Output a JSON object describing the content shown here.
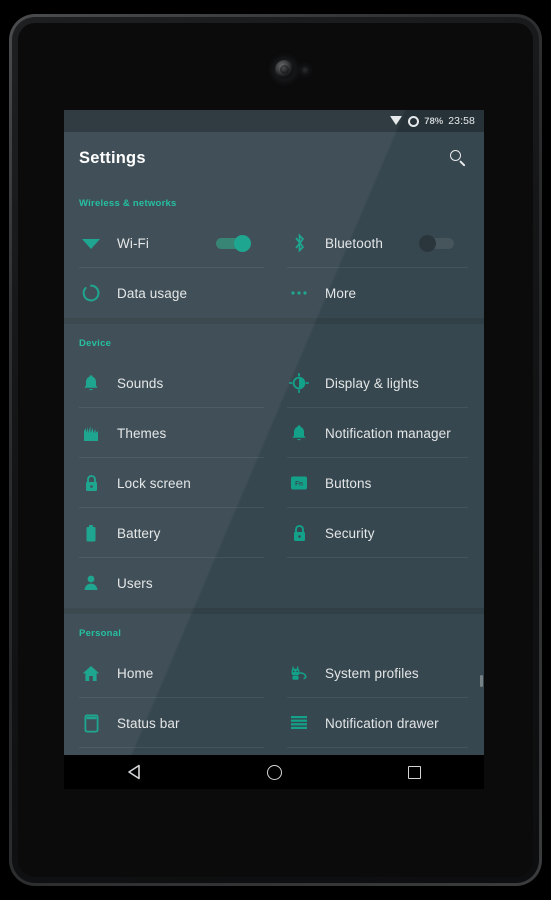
{
  "device": {
    "type": "android-tablet"
  },
  "statusbar": {
    "wifi_icon": "wifi-icon",
    "sync_icon": "ring-icon",
    "battery_percent": "78%",
    "clock": "23:58"
  },
  "appbar": {
    "title": "Settings",
    "search_icon": "search-icon"
  },
  "accent_color": "#1abc9c",
  "screen_bg": "#37474f",
  "sections": [
    {
      "header": "Wireless & networks",
      "items": [
        {
          "label": "Wi-Fi",
          "icon": "wifi-icon",
          "toggle": "on"
        },
        {
          "label": "Bluetooth",
          "icon": "bluetooth-icon",
          "toggle": "off"
        },
        {
          "label": "Data usage",
          "icon": "data-usage-icon"
        },
        {
          "label": "More",
          "icon": "more-icon"
        }
      ]
    },
    {
      "header": "Device",
      "items": [
        {
          "label": "Sounds",
          "icon": "bell-icon"
        },
        {
          "label": "Display & lights",
          "icon": "brightness-icon"
        },
        {
          "label": "Themes",
          "icon": "themes-icon"
        },
        {
          "label": "Notification manager",
          "icon": "bell-icon"
        },
        {
          "label": "Lock screen",
          "icon": "lock-icon"
        },
        {
          "label": "Buttons",
          "icon": "fn-key-icon"
        },
        {
          "label": "Battery",
          "icon": "battery-icon"
        },
        {
          "label": "Security",
          "icon": "lock-icon"
        },
        {
          "label": "Users",
          "icon": "person-icon"
        }
      ]
    },
    {
      "header": "Personal",
      "items": [
        {
          "label": "Home",
          "icon": "home-icon"
        },
        {
          "label": "System profiles",
          "icon": "android-robot-icon"
        },
        {
          "label": "Status bar",
          "icon": "status-bar-icon"
        },
        {
          "label": "Notification drawer",
          "icon": "drawer-lines-icon"
        }
      ]
    }
  ],
  "navbar": {
    "back": "back-icon",
    "home": "home-circle-icon",
    "recents": "recents-square-icon"
  }
}
